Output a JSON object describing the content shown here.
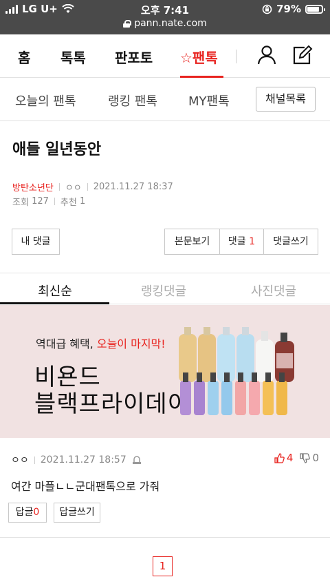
{
  "status": {
    "carrier": "LG U+",
    "time": "오후 7:41",
    "battery": "79%",
    "url": "pann.nate.com"
  },
  "nav": {
    "items": [
      "홈",
      "톡톡",
      "판포토",
      "☆팬톡"
    ]
  },
  "subnav": {
    "items": [
      "오늘의 팬톡",
      "랭킹 팬톡",
      "MY팬톡"
    ],
    "channel_button": "채널목록"
  },
  "post": {
    "title": "애들 일년동안",
    "author": "방탄소년단",
    "nickname": "ㅇㅇ",
    "datetime": "2021.11.27 18:37",
    "views_label": "조회",
    "views": "127",
    "recommend_label": "추천",
    "recommend": "1"
  },
  "actions": {
    "my_comments": "내 댓글",
    "view_post": "본문보기",
    "comments_label": "댓글",
    "comments_count": "1",
    "write_comment": "댓글쓰기"
  },
  "comment_tabs": [
    "최신순",
    "랭킹댓글",
    "사진댓글"
  ],
  "ad": {
    "line1_prefix": "역대급 혜택, ",
    "line1_highlight": "오늘이 마지막!",
    "line2": "비욘드",
    "line3": "블랙프라이데이",
    "colors": {
      "background": "#f1e2e2",
      "accent": "#e8231f"
    }
  },
  "comment": {
    "nickname": "ㅇㅇ",
    "datetime": "2021.11.27 18:57",
    "text": "여간 마플ㄴㄴ군대팬톡으로 가줘",
    "upvotes": "4",
    "downvotes": "0",
    "reply_label": "답글",
    "reply_count": "0",
    "write_reply": "답글쓰기"
  },
  "pagination": {
    "current": "1"
  },
  "colors": {
    "accent": "#e8231f",
    "status_bar": "#4a4a4a"
  }
}
